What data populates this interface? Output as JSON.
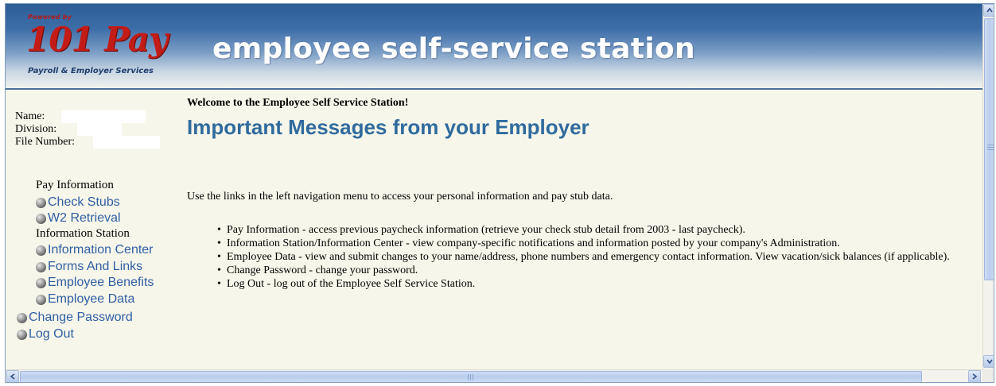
{
  "header": {
    "powered_by": "Powered by",
    "brand": "101 Pay",
    "tagline": "Payroll & Employer Services",
    "app_title": "employee self-service station"
  },
  "sidebar": {
    "name_label": "Name:",
    "division_label": "Division:",
    "file_number_label": "File Number:",
    "sections": [
      {
        "label": "Pay Information"
      },
      {
        "label": "Information Station"
      }
    ],
    "items": [
      {
        "label": "Check Stubs",
        "icon": "bullet-ball-icon"
      },
      {
        "label": "W2 Retrieval",
        "icon": "bullet-ball-icon"
      },
      {
        "label": "Information Center",
        "icon": "bullet-ball-icon"
      },
      {
        "label": "Forms And Links",
        "icon": "bullet-ball-icon"
      },
      {
        "label": "Employee Benefits",
        "icon": "bullet-ball-icon"
      },
      {
        "label": "Employee Data",
        "icon": "bullet-ball-icon"
      },
      {
        "label": "Change Password",
        "icon": "bullet-ball-icon"
      },
      {
        "label": "Log Out",
        "icon": "bullet-ball-icon"
      }
    ]
  },
  "main": {
    "welcome": "Welcome to the Employee Self Service Station!",
    "headline": "Important Messages from your Employer",
    "intro": "Use the links in the left navigation menu to access your personal information and pay stub data.",
    "bullets": [
      "Pay Information - access previous paycheck information (retrieve your check stub detail from 2003 - last paycheck).",
      "Information Station/Information Center - view company-specific notifications and information posted by your company's Administration.",
      "Employee Data - view and submit changes to your name/address, phone numbers and emergency contact information. View vacation/sick balances (if applicable).",
      "Change Password - change your password.",
      "Log Out - log out of the Employee Self Service Station."
    ]
  },
  "colors": {
    "link": "#2f5fa5",
    "headline": "#2f6b9e",
    "brand_red": "#c31c17",
    "header_blue": "#2d5d97",
    "page_background": "#f7f6ea"
  }
}
